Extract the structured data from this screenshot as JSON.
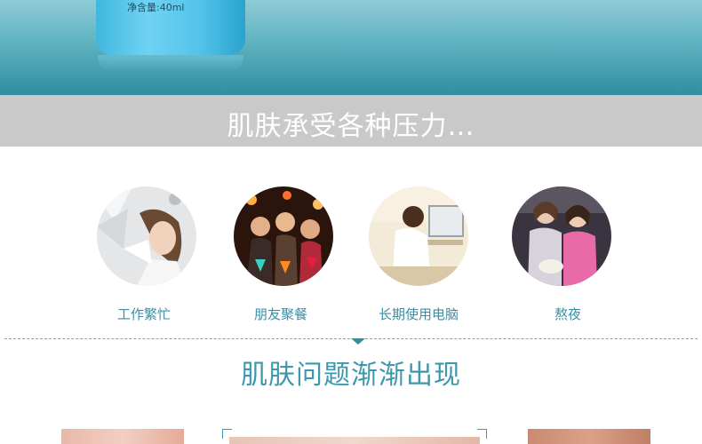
{
  "banner": {
    "bottle_label": "净含量:40ml"
  },
  "pressure_title": "肌肤承受各种压力…",
  "causes": [
    {
      "label": "工作繁忙"
    },
    {
      "label": "朋友聚餐"
    },
    {
      "label": "长期使用电脑"
    },
    {
      "label": "熬夜"
    }
  ],
  "problems_title": "肌肤问题渐渐出现",
  "colors": {
    "accent": "#3d98ad",
    "band": "#c9c9c9",
    "banner": "#5fb2c0"
  }
}
